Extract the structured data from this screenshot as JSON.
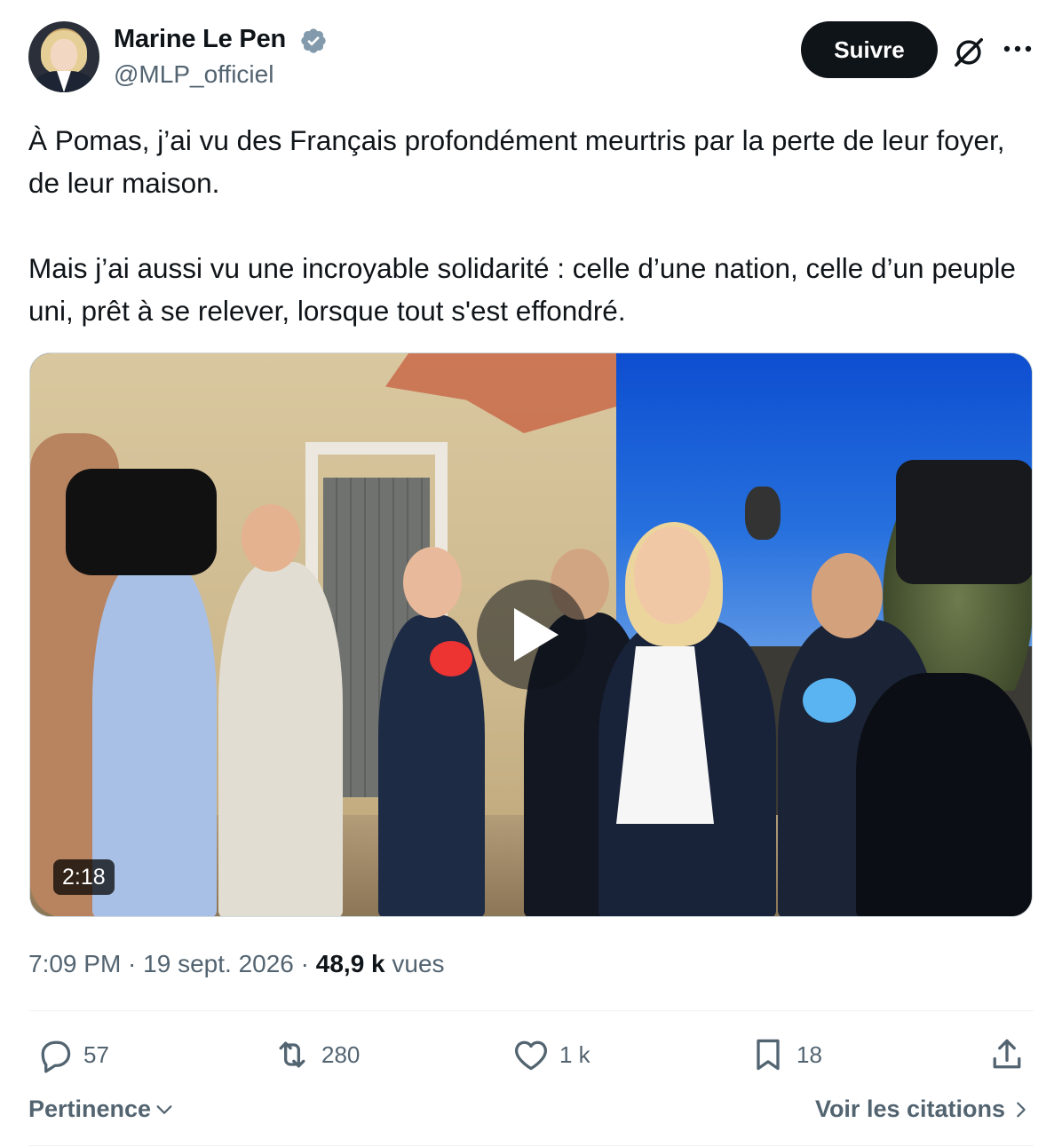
{
  "author": {
    "name": "Marine Le Pen",
    "handle": "@MLP_officiel",
    "verified": true,
    "avatar_icon": "profile-photo"
  },
  "header": {
    "follow_label": "Suivre",
    "grok_icon": "grok-icon",
    "more_icon": "more-icon"
  },
  "tweet": {
    "paragraphs": [
      "À Pomas, j’ai vu des Français profondément meurtris par la perte de leur foyer, de leur maison.",
      "Mais j’ai aussi vu une incroyable solidarité : celle d’une nation, celle d’un peuple uni, prêt à se relever, lorsque tout s'est effondré."
    ]
  },
  "media": {
    "type": "video",
    "duration": "2:18"
  },
  "meta": {
    "time": "7:09 PM",
    "separator": " · ",
    "date": "19 sept. 2026",
    "views_count": "48,9 k",
    "views_label": "vues"
  },
  "actions": {
    "replies": "57",
    "reposts": "280",
    "likes": "1 k",
    "bookmarks": "18"
  },
  "footer": {
    "sort_label": "Pertinence",
    "quotes_label": "Voir les citations"
  },
  "colors": {
    "text": "#0f1419",
    "secondary": "#536471",
    "verified": "#829aab",
    "follow_bg": "#0f1419"
  }
}
